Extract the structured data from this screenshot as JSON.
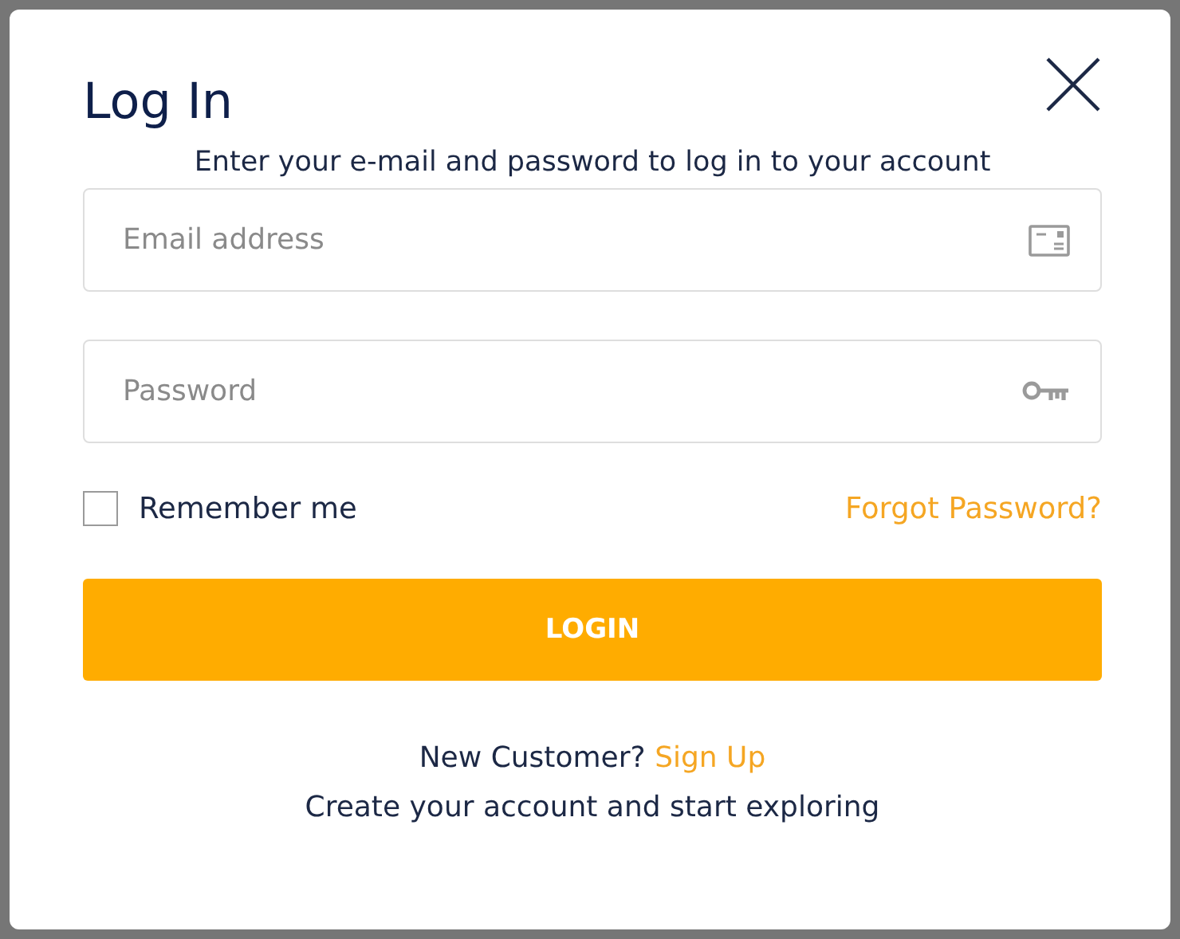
{
  "dialog": {
    "title": "Log In"
  },
  "subtitle": "Enter your e-mail and password to log in to your account",
  "fields": [
    {
      "kind": "email",
      "placeholder": "Email address"
    },
    {
      "kind": "password",
      "placeholder": "Password"
    }
  ],
  "remember": {
    "label": "Remember me",
    "checked": false
  },
  "forgot_link": "Forgot Password?",
  "login_button": "LOGIN",
  "signup": {
    "prompt": "New Customer?",
    "link": "Sign Up"
  },
  "footer_text": "Create your account and start exploring"
}
